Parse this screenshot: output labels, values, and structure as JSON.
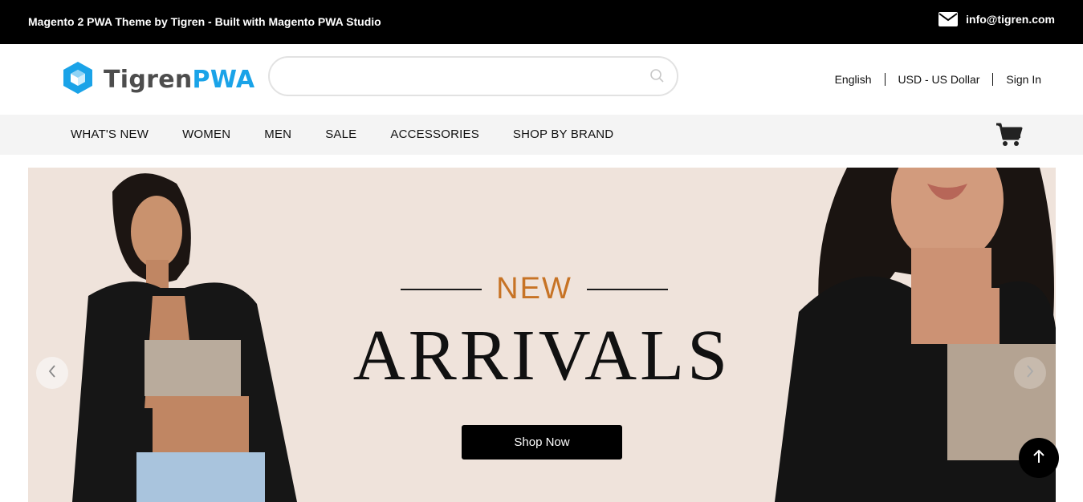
{
  "topbar": {
    "promo_text": "Magento 2 PWA Theme by Tigren - Built with Magento PWA Studio",
    "email": "info@tigren.com",
    "email_icon": "envelope-icon"
  },
  "header": {
    "logo": {
      "part1": "Tigren",
      "part2": "PWA",
      "icon": "cube-icon"
    },
    "search": {
      "value": "",
      "placeholder": "",
      "icon": "search-icon"
    },
    "language": "English",
    "currency": "USD - US Dollar",
    "sign_in": "Sign In"
  },
  "nav": {
    "items": [
      {
        "label": "WHAT'S NEW"
      },
      {
        "label": "WOMEN"
      },
      {
        "label": "MEN"
      },
      {
        "label": "SALE"
      },
      {
        "label": "ACCESSORIES"
      },
      {
        "label": "SHOP BY BRAND"
      }
    ],
    "cart_icon": "cart-icon"
  },
  "banner": {
    "new_label": "NEW",
    "arrivals_label": "ARRIVALS",
    "cta_label": "Shop Now",
    "prev_icon": "chevron-left-icon",
    "next_icon": "chevron-right-icon"
  },
  "scroll_top_icon": "arrow-up-icon",
  "colors": {
    "topbar_bg": "#000000",
    "brand_blue": "#1aa3e8",
    "brand_grey": "#4d4d4d",
    "nav_bg": "#f4f4f4",
    "banner_bg": "#efe3db",
    "accent_orange": "#c77325"
  }
}
